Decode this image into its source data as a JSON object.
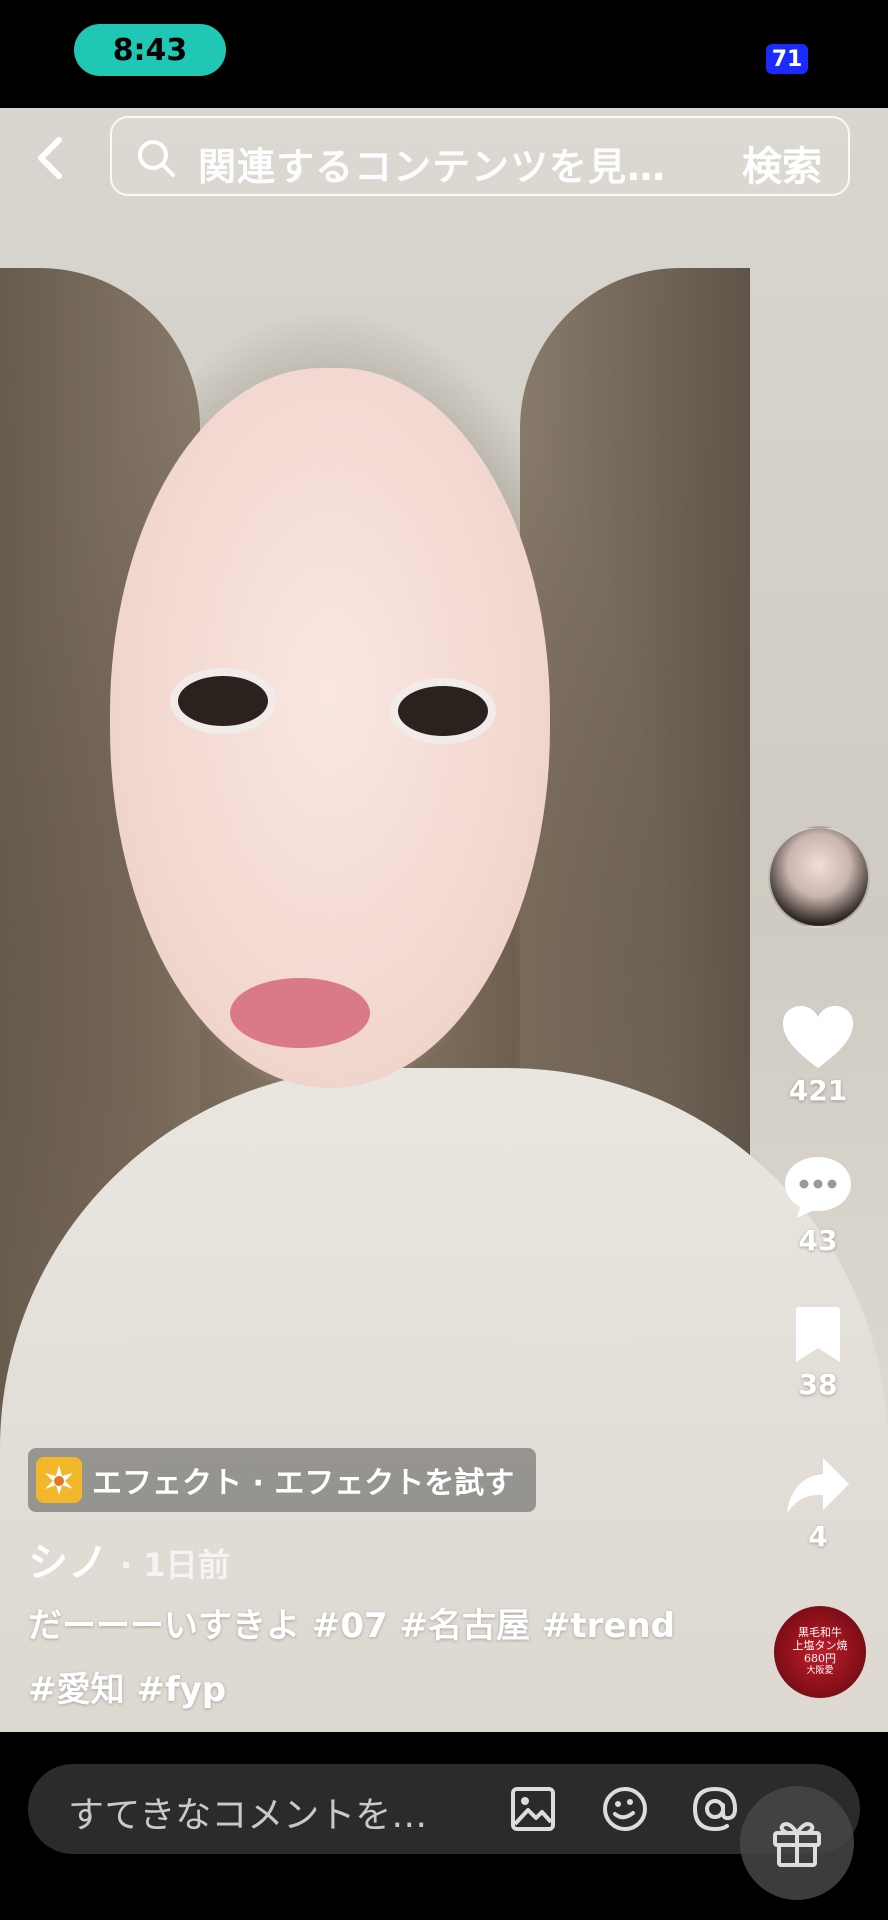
{
  "status_bar": {
    "time": "8:43",
    "battery": "71"
  },
  "search": {
    "query": "関連するコンテンツを見…",
    "button_label": "検索"
  },
  "actions": {
    "like_count": "421",
    "comment_count": "43",
    "bookmark_count": "38",
    "share_count": "4"
  },
  "music_disc": {
    "line1": "黒毛和牛",
    "line2": "上塩タン焼",
    "line3": "680円",
    "line4": "大阪愛"
  },
  "post": {
    "effect_label": "エフェクト · エフェクトを試す",
    "author": "シノ",
    "posted_ago": "· 1日前",
    "caption_text": "だーーーいすきよ",
    "hashtags_line1": [
      "#07",
      "#名古屋",
      "#trend"
    ],
    "hashtags_line2": [
      "#愛知",
      "#fyp"
    ]
  },
  "comment_bar": {
    "placeholder": "すてきなコメントを…"
  },
  "icons": [
    "back-chevron-icon",
    "search-icon",
    "heart-icon",
    "comment-bubble-icon",
    "bookmark-icon",
    "share-arrow-icon",
    "image-icon",
    "emoji-icon",
    "at-sign-icon",
    "gift-icon"
  ]
}
